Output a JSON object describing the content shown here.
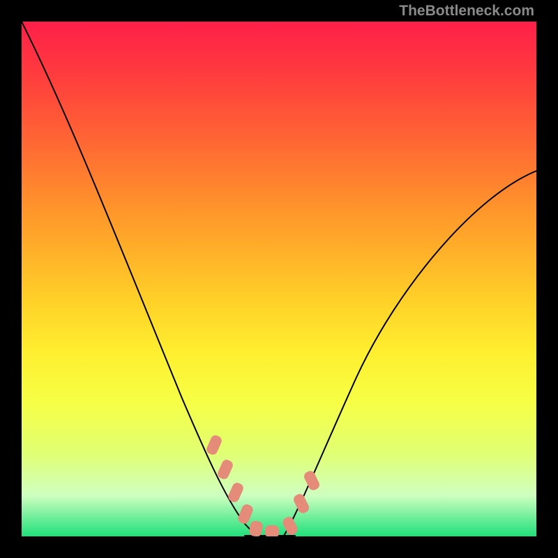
{
  "watermark": "TheBottleneck.com",
  "chart_data": {
    "type": "line",
    "title": "",
    "xlabel": "",
    "ylabel": "",
    "xlim": [
      0,
      100
    ],
    "ylim": [
      0,
      100
    ],
    "series": [
      {
        "name": "left-branch",
        "x": [
          0,
          5,
          10,
          15,
          20,
          25,
          30,
          35,
          40,
          43,
          46
        ],
        "values": [
          100,
          85,
          73,
          62,
          52,
          42,
          32,
          22,
          11,
          4,
          0
        ]
      },
      {
        "name": "valley-floor",
        "x": [
          43,
          53
        ],
        "values": [
          0,
          0
        ]
      },
      {
        "name": "right-branch",
        "x": [
          50,
          55,
          60,
          65,
          70,
          75,
          80,
          85,
          90,
          95,
          100
        ],
        "values": [
          0,
          10,
          22,
          33,
          42,
          50,
          57,
          62,
          66,
          69,
          71
        ]
      }
    ],
    "annotations": [
      {
        "name": "left-marker-group",
        "shape": "rounded-rect",
        "color": "#e58b7a",
        "points_x": [
          37,
          39,
          41,
          43,
          46,
          48
        ],
        "points_y": [
          18,
          13,
          8,
          4,
          0,
          0
        ]
      },
      {
        "name": "right-marker-group",
        "shape": "rounded-rect",
        "color": "#e58b7a",
        "points_x": [
          52,
          54,
          56
        ],
        "points_y": [
          4,
          9,
          13
        ]
      }
    ],
    "background_gradient": {
      "direction": "vertical",
      "stops": [
        {
          "pos": 0.0,
          "color": "#ff1f49"
        },
        {
          "pos": 0.24,
          "color": "#ff6933"
        },
        {
          "pos": 0.54,
          "color": "#ffd028"
        },
        {
          "pos": 0.74,
          "color": "#f6ff45"
        },
        {
          "pos": 1.0,
          "color": "#1fe07a"
        }
      ]
    }
  }
}
